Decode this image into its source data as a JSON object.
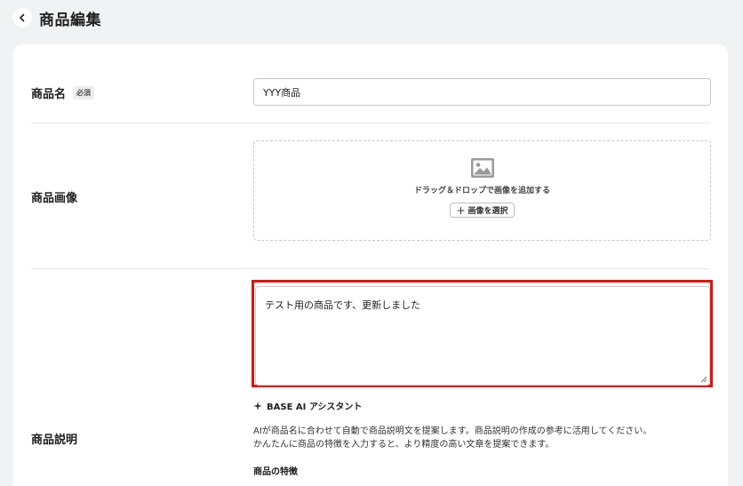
{
  "header": {
    "title": "商品編集"
  },
  "fields": {
    "name": {
      "label": "商品名",
      "required_badge": "必須",
      "value": "YYY商品"
    },
    "image": {
      "label": "商品画像",
      "drop_text": "ドラッグ＆ドロップで画像を追加する",
      "select_button": "画像を選択"
    },
    "description": {
      "label": "商品説明",
      "value": "テスト用の商品です、更新しました"
    }
  },
  "ai_assistant": {
    "title": "BASE AI アシスタント",
    "description_lines": [
      "AIが商品名に合わせて自動で商品説明文を提案します。商品説明の作成の参考に活用してください。",
      "かんたんに商品の特徴を入力すると、より精度の高い文章を提案できます。"
    ],
    "features_label": "商品の特徴"
  },
  "colors": {
    "highlight": "#e3120b",
    "background": "#f1f2f3"
  },
  "icons": [
    "chevron-left-icon",
    "image-icon",
    "plus-icon",
    "sparkle-icon",
    "resize-grip-icon"
  ]
}
